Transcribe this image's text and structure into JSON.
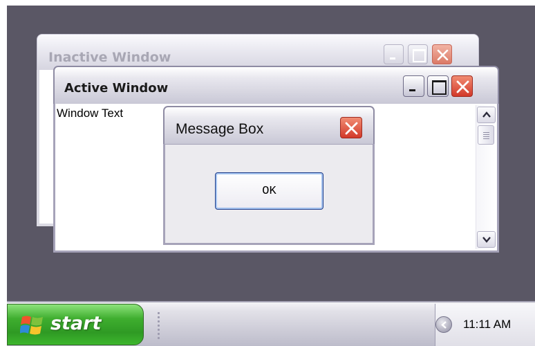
{
  "desktop": {
    "background": "#5a5765"
  },
  "inactive_window": {
    "title": "Inactive Window"
  },
  "active_window": {
    "title": "Active Window",
    "body_text": "Window Text"
  },
  "message_box": {
    "title": "Message Box",
    "ok_label": "OK"
  },
  "taskbar": {
    "start_label": "start",
    "clock": "11:11 AM"
  },
  "colors": {
    "start_button": "#3fae2f",
    "close_button": "#d2392a",
    "active_border": "#8e8ba3"
  }
}
